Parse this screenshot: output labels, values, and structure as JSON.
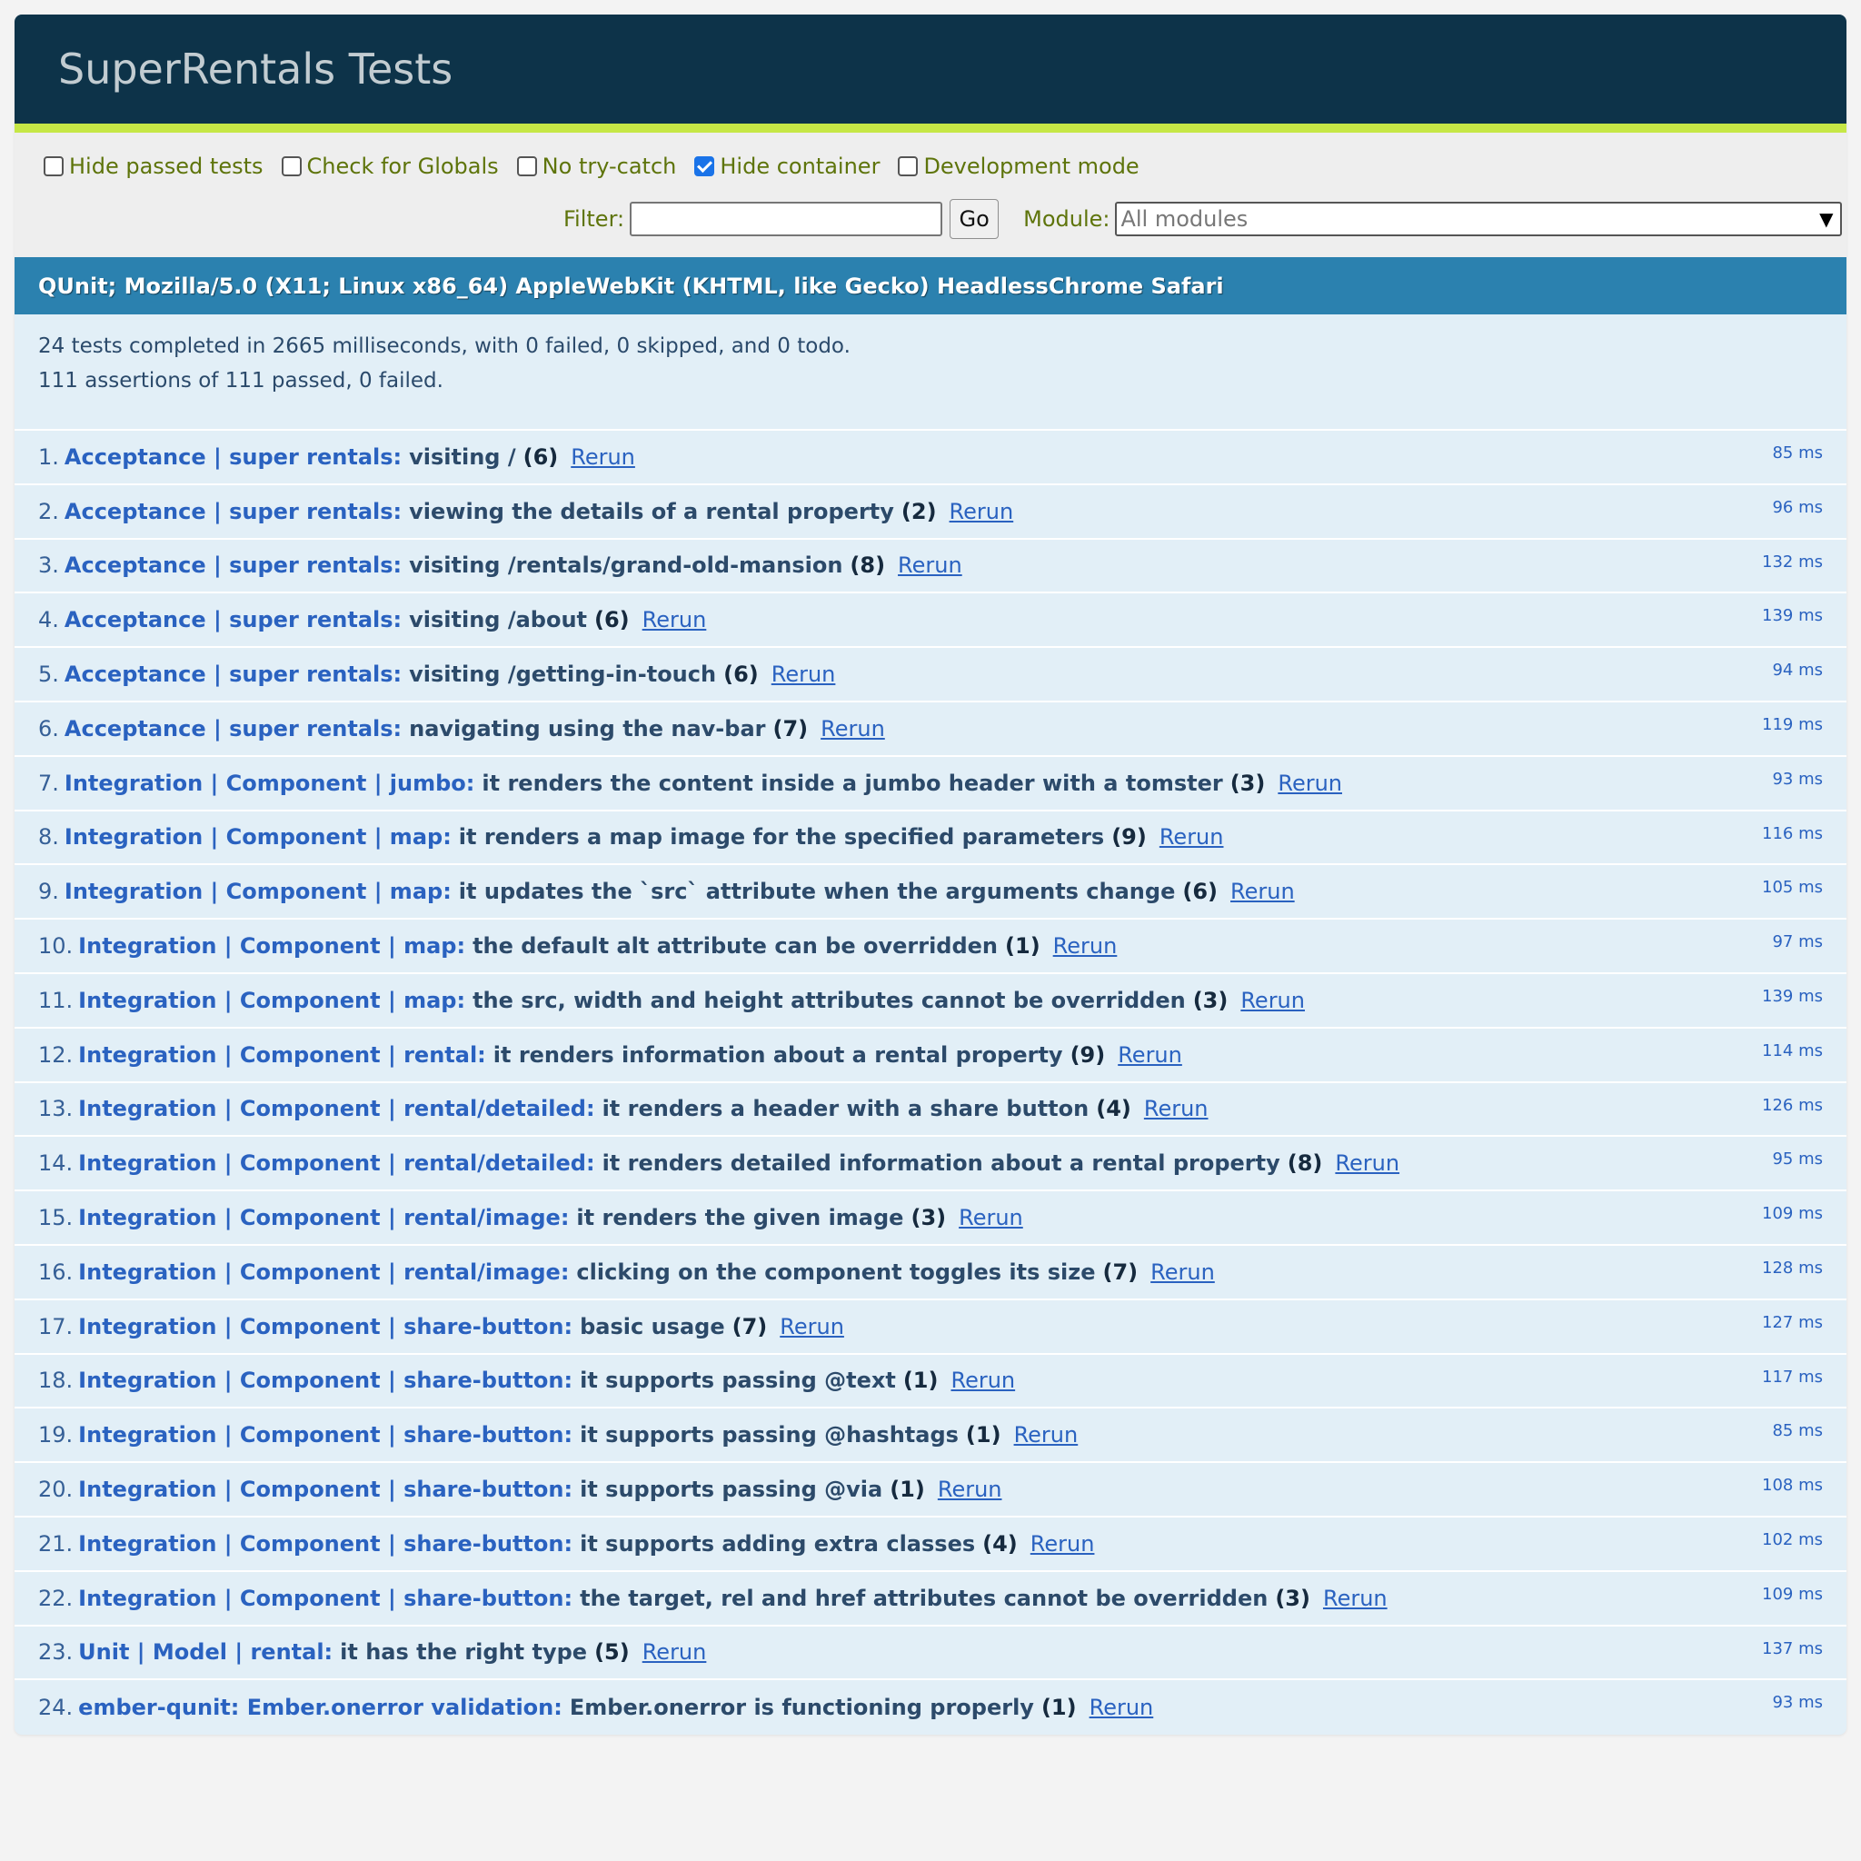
{
  "header": {
    "title": "SuperRentals Tests"
  },
  "toolbar": {
    "options": [
      {
        "label": "Hide passed tests",
        "checked": false
      },
      {
        "label": "Check for Globals",
        "checked": false
      },
      {
        "label": "No try-catch",
        "checked": false
      },
      {
        "label": "Hide container",
        "checked": true
      },
      {
        "label": "Development mode",
        "checked": false
      }
    ],
    "filter_label": "Filter:",
    "filter_value": "",
    "go_label": "Go",
    "module_label": "Module:",
    "module_value": "All modules",
    "module_arrow": "▼"
  },
  "banner": {
    "user_agent": "QUnit; Mozilla/5.0 (X11; Linux x86_64) AppleWebKit (KHTML, like Gecko) HeadlessChrome Safari"
  },
  "result": {
    "line1": "24 tests completed in 2665 milliseconds, with 0 failed, 0 skipped, and 0 todo.",
    "line2": "111 assertions of 111 passed, 0 failed."
  },
  "rerun_label": "Rerun",
  "tests": [
    {
      "num": "1.",
      "module": "Acceptance | super rentals:",
      "name": "visiting /",
      "counts": "(6)",
      "runtime": "85 ms"
    },
    {
      "num": "2.",
      "module": "Acceptance | super rentals:",
      "name": "viewing the details of a rental property",
      "counts": "(2)",
      "runtime": "96 ms"
    },
    {
      "num": "3.",
      "module": "Acceptance | super rentals:",
      "name": "visiting /rentals/grand-old-mansion",
      "counts": "(8)",
      "runtime": "132 ms"
    },
    {
      "num": "4.",
      "module": "Acceptance | super rentals:",
      "name": "visiting /about",
      "counts": "(6)",
      "runtime": "139 ms"
    },
    {
      "num": "5.",
      "module": "Acceptance | super rentals:",
      "name": "visiting /getting-in-touch",
      "counts": "(6)",
      "runtime": "94 ms"
    },
    {
      "num": "6.",
      "module": "Acceptance | super rentals:",
      "name": "navigating using the nav-bar",
      "counts": "(7)",
      "runtime": "119 ms"
    },
    {
      "num": "7.",
      "module": "Integration | Component | jumbo:",
      "name": "it renders the content inside a jumbo header with a tomster",
      "counts": "(3)",
      "runtime": "93 ms"
    },
    {
      "num": "8.",
      "module": "Integration | Component | map:",
      "name": "it renders a map image for the specified parameters",
      "counts": "(9)",
      "runtime": "116 ms"
    },
    {
      "num": "9.",
      "module": "Integration | Component | map:",
      "name": "it updates the `src` attribute when the arguments change",
      "counts": "(6)",
      "runtime": "105 ms"
    },
    {
      "num": "10.",
      "module": "Integration | Component | map:",
      "name": "the default alt attribute can be overridden",
      "counts": "(1)",
      "runtime": "97 ms"
    },
    {
      "num": "11.",
      "module": "Integration | Component | map:",
      "name": "the src, width and height attributes cannot be overridden",
      "counts": "(3)",
      "runtime": "139 ms"
    },
    {
      "num": "12.",
      "module": "Integration | Component | rental:",
      "name": "it renders information about a rental property",
      "counts": "(9)",
      "runtime": "114 ms"
    },
    {
      "num": "13.",
      "module": "Integration | Component | rental/detailed:",
      "name": "it renders a header with a share button",
      "counts": "(4)",
      "runtime": "126 ms"
    },
    {
      "num": "14.",
      "module": "Integration | Component | rental/detailed:",
      "name": "it renders detailed information about a rental property",
      "counts": "(8)",
      "runtime": "95 ms"
    },
    {
      "num": "15.",
      "module": "Integration | Component | rental/image:",
      "name": "it renders the given image",
      "counts": "(3)",
      "runtime": "109 ms"
    },
    {
      "num": "16.",
      "module": "Integration | Component | rental/image:",
      "name": "clicking on the component toggles its size",
      "counts": "(7)",
      "runtime": "128 ms"
    },
    {
      "num": "17.",
      "module": "Integration | Component | share-button:",
      "name": "basic usage",
      "counts": "(7)",
      "runtime": "127 ms"
    },
    {
      "num": "18.",
      "module": "Integration | Component | share-button:",
      "name": "it supports passing @text",
      "counts": "(1)",
      "runtime": "117 ms"
    },
    {
      "num": "19.",
      "module": "Integration | Component | share-button:",
      "name": "it supports passing @hashtags",
      "counts": "(1)",
      "runtime": "85 ms"
    },
    {
      "num": "20.",
      "module": "Integration | Component | share-button:",
      "name": "it supports passing @via",
      "counts": "(1)",
      "runtime": "108 ms"
    },
    {
      "num": "21.",
      "module": "Integration | Component | share-button:",
      "name": "it supports adding extra classes",
      "counts": "(4)",
      "runtime": "102 ms"
    },
    {
      "num": "22.",
      "module": "Integration | Component | share-button:",
      "name": "the target, rel and href attributes cannot be overridden",
      "counts": "(3)",
      "runtime": "109 ms"
    },
    {
      "num": "23.",
      "module": "Unit | Model | rental:",
      "name": "it has the right type",
      "counts": "(5)",
      "runtime": "137 ms"
    },
    {
      "num": "24.",
      "module": "ember-qunit: Ember.onerror validation:",
      "name": "Ember.onerror is functioning properly",
      "counts": "(1)",
      "runtime": "93 ms"
    }
  ]
}
